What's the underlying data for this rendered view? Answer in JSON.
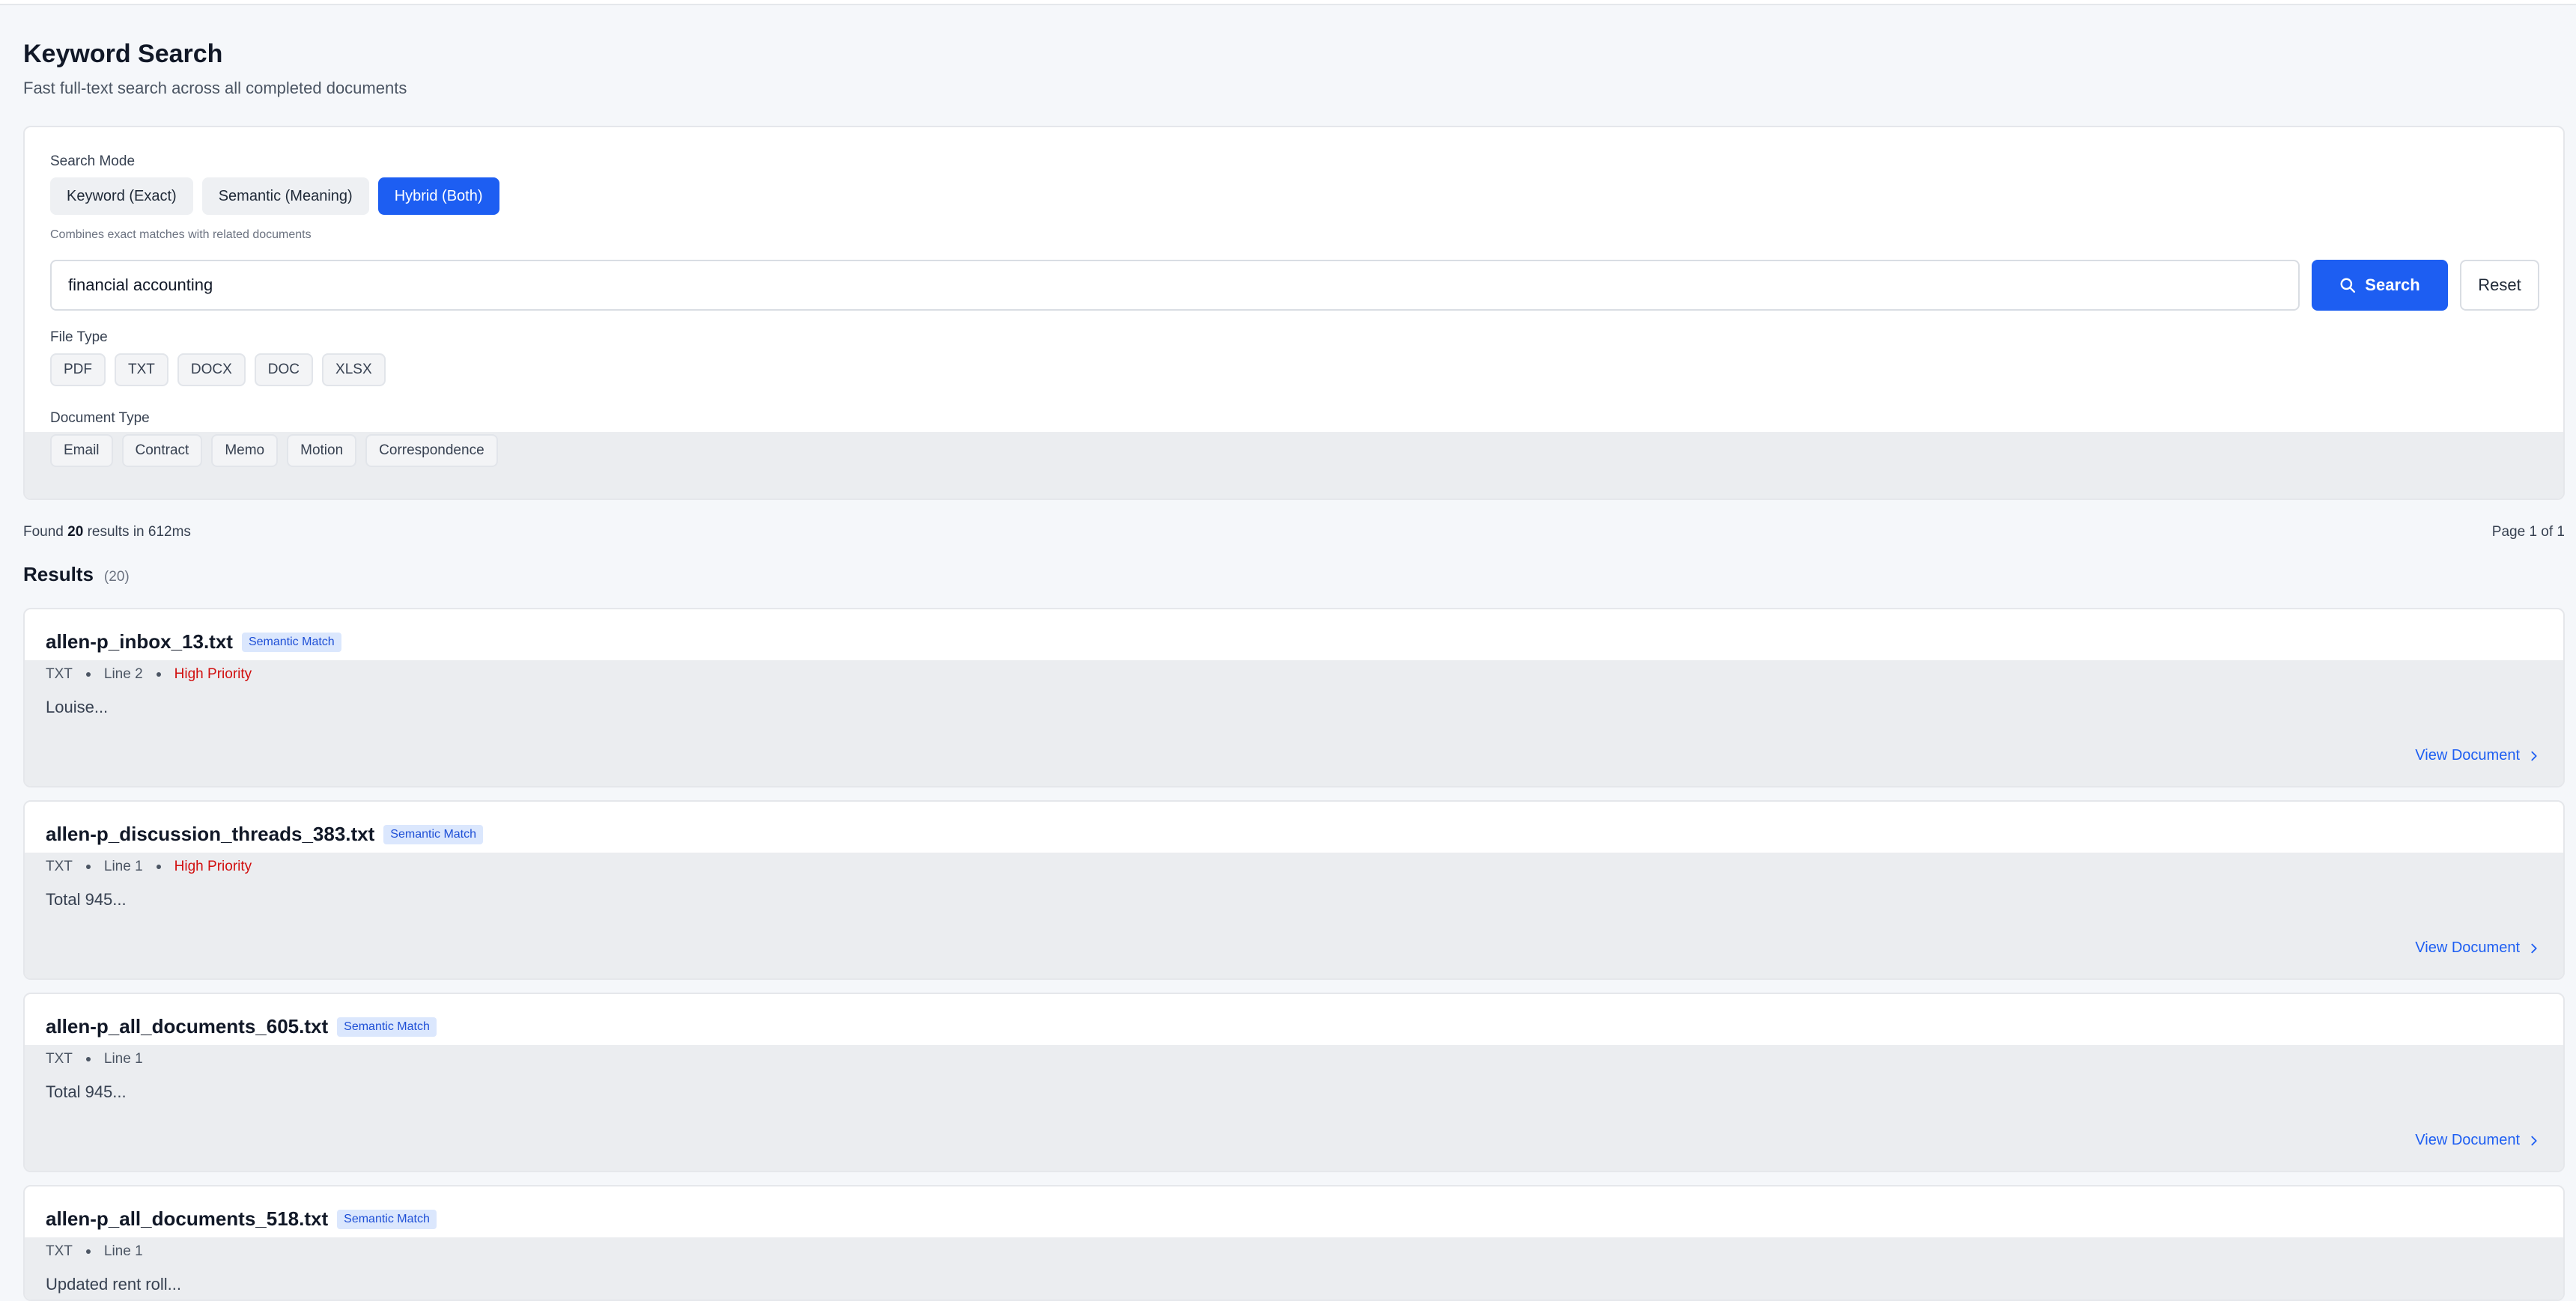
{
  "header": {
    "title": "Keyword Search",
    "subtitle": "Fast full-text search across all completed documents"
  },
  "search": {
    "mode_label": "Search Mode",
    "modes": [
      {
        "label": "Keyword (Exact)",
        "active": false
      },
      {
        "label": "Semantic (Meaning)",
        "active": false
      },
      {
        "label": "Hybrid (Both)",
        "active": true
      }
    ],
    "mode_hint": "Combines exact matches with related documents",
    "query": "financial accounting",
    "search_button": "Search",
    "reset_button": "Reset",
    "file_type_label": "File Type",
    "file_types": [
      "PDF",
      "TXT",
      "DOCX",
      "DOC",
      "XLSX"
    ],
    "doc_type_label": "Document Type",
    "doc_types": [
      "Email",
      "Contract",
      "Memo",
      "Motion",
      "Correspondence"
    ]
  },
  "summary": {
    "prefix": "Found ",
    "count": "20",
    "suffix": " results in 612ms",
    "page": "Page 1 of 1"
  },
  "results": {
    "title": "Results",
    "count": "(20)",
    "view_label": "View Document",
    "items": [
      {
        "filename": "allen-p_inbox_13.txt",
        "badge": "Semantic Match",
        "type": "TXT",
        "line": "Line 2",
        "priority": "High Priority",
        "snippet": "Louise..."
      },
      {
        "filename": "allen-p_discussion_threads_383.txt",
        "badge": "Semantic Match",
        "type": "TXT",
        "line": "Line 1",
        "priority": "High Priority",
        "snippet": "Total 945..."
      },
      {
        "filename": "allen-p_all_documents_605.txt",
        "badge": "Semantic Match",
        "type": "TXT",
        "line": "Line 1",
        "priority": "",
        "snippet": "Total 945..."
      },
      {
        "filename": "allen-p_all_documents_518.txt",
        "badge": "Semantic Match",
        "type": "TXT",
        "line": "Line 1",
        "priority": "",
        "snippet": "Updated rent roll..."
      }
    ]
  },
  "colors": {
    "accent": "#1d5ef2",
    "priority": "#d10f0f",
    "badge_bg": "#dbe7fd"
  }
}
